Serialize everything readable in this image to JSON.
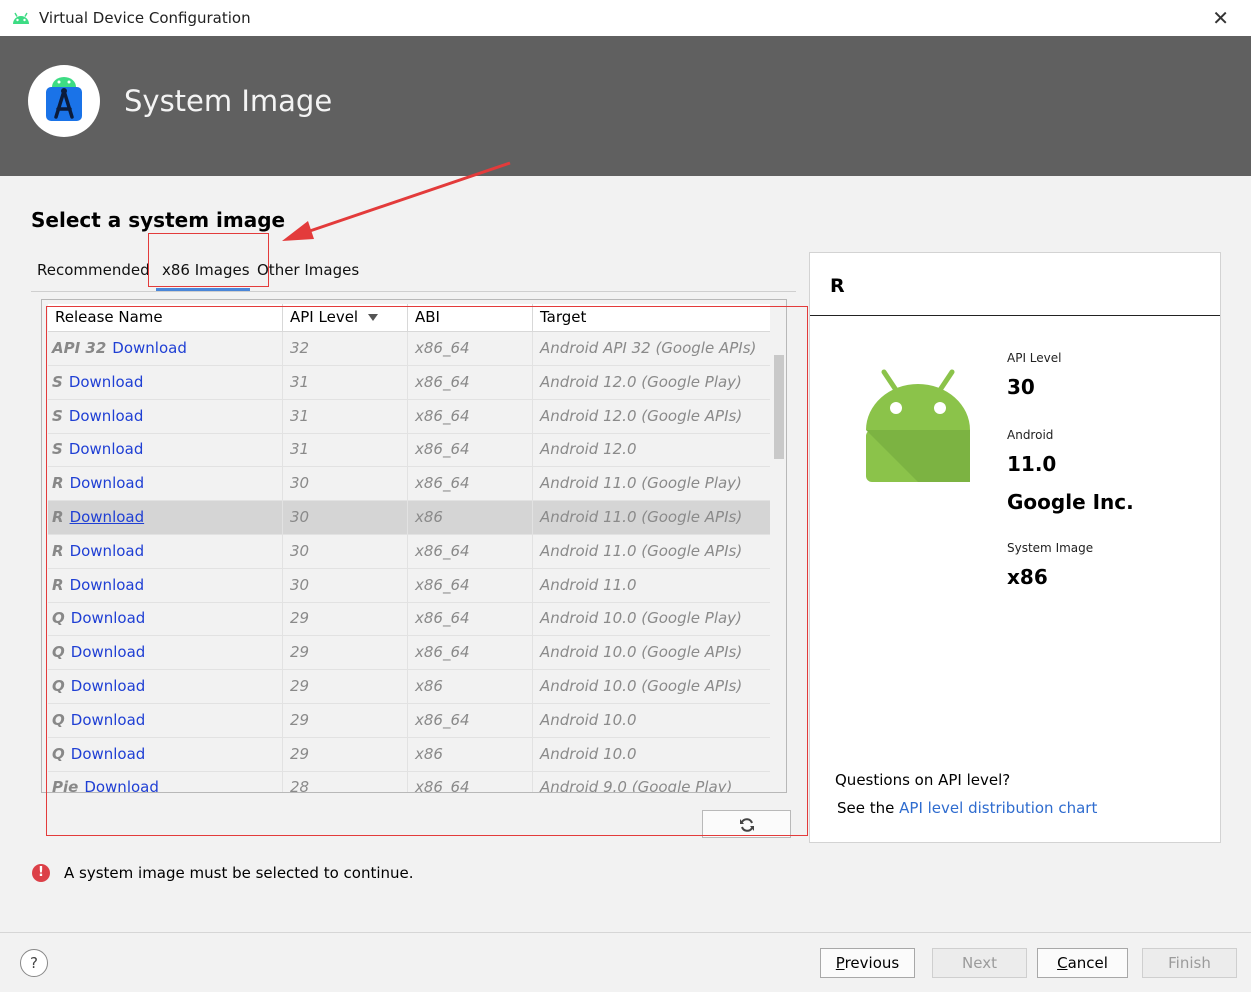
{
  "window": {
    "title": "Virtual Device Configuration",
    "close_glyph": "✕"
  },
  "header": {
    "title": "System Image"
  },
  "page": {
    "section_title": "Select a system image"
  },
  "tabs": [
    {
      "label": "Recommended",
      "selected": false
    },
    {
      "label": "x86 Images",
      "selected": true
    },
    {
      "label": "Other Images",
      "selected": false
    }
  ],
  "table": {
    "columns": [
      "Release Name",
      "API Level",
      "ABI",
      "Target"
    ],
    "sort_column": "API Level",
    "rows": [
      {
        "release": "API 32",
        "link": "Download",
        "api": "32",
        "abi": "x86_64",
        "target": "Android API 32 (Google APIs)"
      },
      {
        "release": "S",
        "link": "Download",
        "api": "31",
        "abi": "x86_64",
        "target": "Android 12.0 (Google Play)"
      },
      {
        "release": "S",
        "link": "Download",
        "api": "31",
        "abi": "x86_64",
        "target": "Android 12.0 (Google APIs)"
      },
      {
        "release": "S",
        "link": "Download",
        "api": "31",
        "abi": "x86_64",
        "target": "Android 12.0"
      },
      {
        "release": "R",
        "link": "Download",
        "api": "30",
        "abi": "x86_64",
        "target": "Android 11.0 (Google Play)"
      },
      {
        "release": "R",
        "link": "Download",
        "api": "30",
        "abi": "x86",
        "target": "Android 11.0 (Google APIs)",
        "selected": true
      },
      {
        "release": "R",
        "link": "Download",
        "api": "30",
        "abi": "x86_64",
        "target": "Android 11.0 (Google APIs)"
      },
      {
        "release": "R",
        "link": "Download",
        "api": "30",
        "abi": "x86_64",
        "target": "Android 11.0"
      },
      {
        "release": "Q",
        "link": "Download",
        "api": "29",
        "abi": "x86_64",
        "target": "Android 10.0 (Google Play)"
      },
      {
        "release": "Q",
        "link": "Download",
        "api": "29",
        "abi": "x86_64",
        "target": "Android 10.0 (Google APIs)"
      },
      {
        "release": "Q",
        "link": "Download",
        "api": "29",
        "abi": "x86",
        "target": "Android 10.0 (Google APIs)"
      },
      {
        "release": "Q",
        "link": "Download",
        "api": "29",
        "abi": "x86_64",
        "target": "Android 10.0"
      },
      {
        "release": "Q",
        "link": "Download",
        "api": "29",
        "abi": "x86",
        "target": "Android 10.0"
      },
      {
        "release": "Pie",
        "link": "Download",
        "api": "28",
        "abi": "x86_64",
        "target": "Android 9.0 (Google Play)"
      }
    ]
  },
  "refresh_icon": "refresh-icon",
  "detail": {
    "release": "R",
    "api_level_label": "API Level",
    "api_level": "30",
    "android_label": "Android",
    "android_version": "11.0",
    "vendor": "Google Inc.",
    "system_image_label": "System Image",
    "system_image": "x86",
    "question": "Questions on API level?",
    "see_prefix": "See the ",
    "chart_link": "API level distribution chart"
  },
  "error": {
    "icon": "!",
    "message": "A system image must be selected to continue."
  },
  "footer": {
    "help": "?",
    "previous": {
      "mnemonic": "P",
      "rest": "revious"
    },
    "next": "Next",
    "cancel": {
      "mnemonic": "C",
      "rest": "ancel"
    },
    "finish": "Finish"
  },
  "colors": {
    "header_bg": "#606060",
    "link": "#1f3fd4",
    "annotation_red": "#e33b3b",
    "tab_accent": "#4a86d8",
    "android_green": "#8bc34a"
  }
}
